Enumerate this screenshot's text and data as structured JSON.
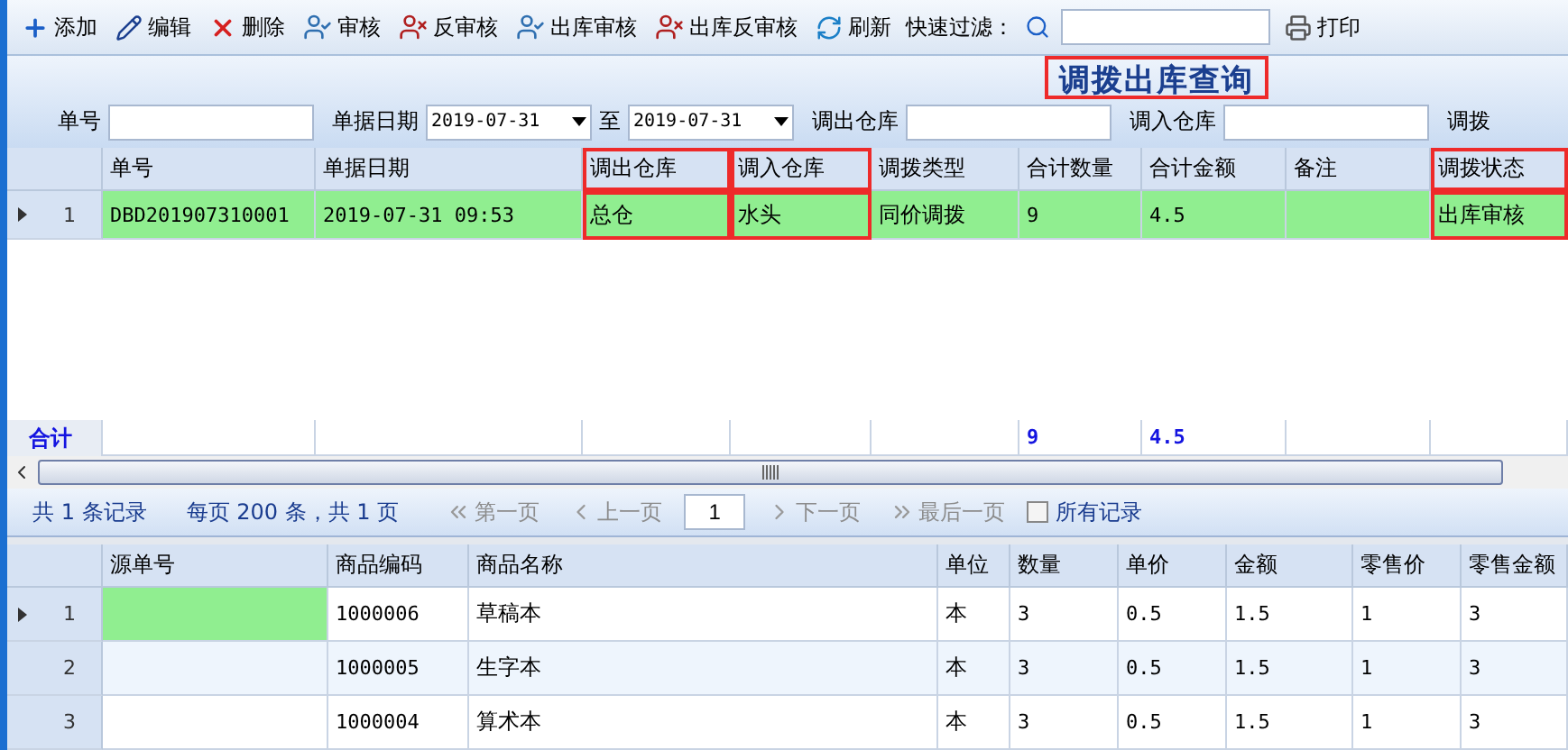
{
  "toolbar": {
    "buttons": [
      {
        "label": "添加",
        "kind": "add"
      },
      {
        "label": "编辑",
        "kind": "edit"
      },
      {
        "label": "删除",
        "kind": "delete"
      },
      {
        "label": "审核",
        "kind": "approve"
      },
      {
        "label": "反审核",
        "kind": "unapprove"
      },
      {
        "label": "出库审核",
        "kind": "approve"
      },
      {
        "label": "出库反审核",
        "kind": "unapprove"
      },
      {
        "label": "刷新",
        "kind": "refresh"
      }
    ],
    "quick_filter": {
      "label": "快速过滤："
    },
    "print": {
      "label": "打印"
    }
  },
  "title": {
    "text": "调拨出库查询",
    "highlighted": true
  },
  "filters": [
    {
      "kind": "text",
      "label": "单号"
    },
    {
      "kind": "daterange",
      "label": "单据日期",
      "from": "2019-07-31",
      "separator": "至",
      "to": "2019-07-31"
    },
    {
      "kind": "text",
      "label": "调出仓库"
    },
    {
      "kind": "text",
      "label": "调入仓库"
    },
    {
      "kind": "label",
      "label": "调拨"
    }
  ],
  "orders": {
    "columns": [
      {
        "label": "单号",
        "highlighted": false
      },
      {
        "label": "单据日期",
        "highlighted": false
      },
      {
        "label": "调出仓库",
        "highlighted": true
      },
      {
        "label": "调入仓库",
        "highlighted": true
      },
      {
        "label": "调拨类型",
        "highlighted": false
      },
      {
        "label": "合计数量",
        "highlighted": false
      },
      {
        "label": "合计金额",
        "highlighted": false
      },
      {
        "label": "备注",
        "highlighted": false
      },
      {
        "label": "调拨状态",
        "highlighted": true
      }
    ],
    "rows": [
      {
        "index": "1",
        "selected": true,
        "cells": [
          {
            "text": "DBD201907310001",
            "highlighted": false
          },
          {
            "text": "2019-07-31 09:53",
            "highlighted": false
          },
          {
            "text": "总仓",
            "highlighted": true
          },
          {
            "text": "水头",
            "highlighted": true
          },
          {
            "text": "同价调拨",
            "highlighted": false
          },
          {
            "text": "9",
            "highlighted": false
          },
          {
            "text": "4.5",
            "highlighted": false
          },
          {
            "text": null,
            "highlighted": false
          },
          {
            "text": "出库审核",
            "highlighted": true
          }
        ]
      }
    ],
    "totals": {
      "label": "合计",
      "quantity": "9",
      "amount": "4.5"
    }
  },
  "pager": {
    "summary": "共 1 条记录",
    "per_page": "每页 200 条，共 1 页",
    "buttons": [
      {
        "label": "第一页",
        "kind": "first",
        "disabled": true
      },
      {
        "label": "上一页",
        "kind": "prev",
        "disabled": true
      },
      {
        "label": "下一页",
        "kind": "next",
        "disabled": true
      },
      {
        "label": "最后一页",
        "kind": "last",
        "disabled": true
      }
    ],
    "page": "1",
    "all_records": {
      "label": "所有记录",
      "checked": false
    }
  },
  "items": {
    "columns": [
      "源单号",
      "商品编码",
      "商品名称",
      "单位",
      "数量",
      "单价",
      "金额",
      "零售价",
      "零售金额"
    ],
    "rows": [
      {
        "index": "1",
        "selected": true,
        "cells": [
          null,
          "1000006",
          "草稿本",
          "本",
          "3",
          "0.5",
          "1.5",
          "1",
          "3"
        ]
      },
      {
        "index": "2",
        "selected": false,
        "cells": [
          null,
          "1000005",
          "生字本",
          "本",
          "3",
          "0.5",
          "1.5",
          "1",
          "3"
        ]
      },
      {
        "index": "3",
        "selected": false,
        "cells": [
          null,
          "1000004",
          "算术本",
          "本",
          "3",
          "0.5",
          "1.5",
          "1",
          "3"
        ]
      }
    ]
  }
}
